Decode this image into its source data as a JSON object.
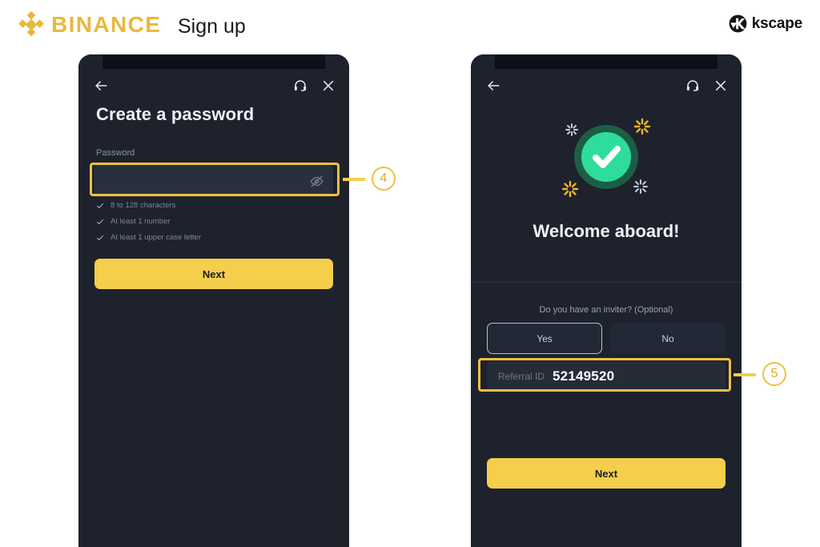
{
  "header": {
    "brand_name": "BINANCE",
    "brand_icon": "binance-diamond-logo",
    "page_title": "Sign up",
    "partner_logo_name": "kscape-logo-icon",
    "partner_name": "kscape",
    "brand_color": "#E8B93A"
  },
  "phone_left": {
    "topbar": {
      "back_icon": "back-arrow-icon",
      "support_icon": "headset-support-icon",
      "close_icon": "close-x-icon"
    },
    "title": "Create a password",
    "password": {
      "label": "Password",
      "value": "",
      "placeholder": "",
      "visibility_icon": "eye-off-icon"
    },
    "requirements": [
      {
        "icon": "check-icon",
        "text": "8 to 128 characters"
      },
      {
        "icon": "check-icon",
        "text": "At least 1 number"
      },
      {
        "icon": "check-icon",
        "text": "At least 1 upper case letter"
      }
    ],
    "next_label": "Next"
  },
  "phone_right": {
    "topbar": {
      "back_icon": "back-arrow-icon",
      "support_icon": "headset-support-icon",
      "close_icon": "close-x-icon"
    },
    "success": {
      "icon": "green-check-circle-icon",
      "sparkle_icon": "sparkle-burst-icon",
      "heading": "Welcome aboard!",
      "accent_color": "#2EDD9B"
    },
    "inviter": {
      "question": "Do you have an inviter? (Optional)",
      "yes_label": "Yes",
      "no_label": "No",
      "selected": "Yes"
    },
    "referral": {
      "label": "Referral ID",
      "value": "52149520"
    },
    "next_label": "Next"
  },
  "callouts": [
    {
      "number": "4",
      "target": "password-input"
    },
    {
      "number": "5",
      "target": "referral-id-field"
    }
  ]
}
